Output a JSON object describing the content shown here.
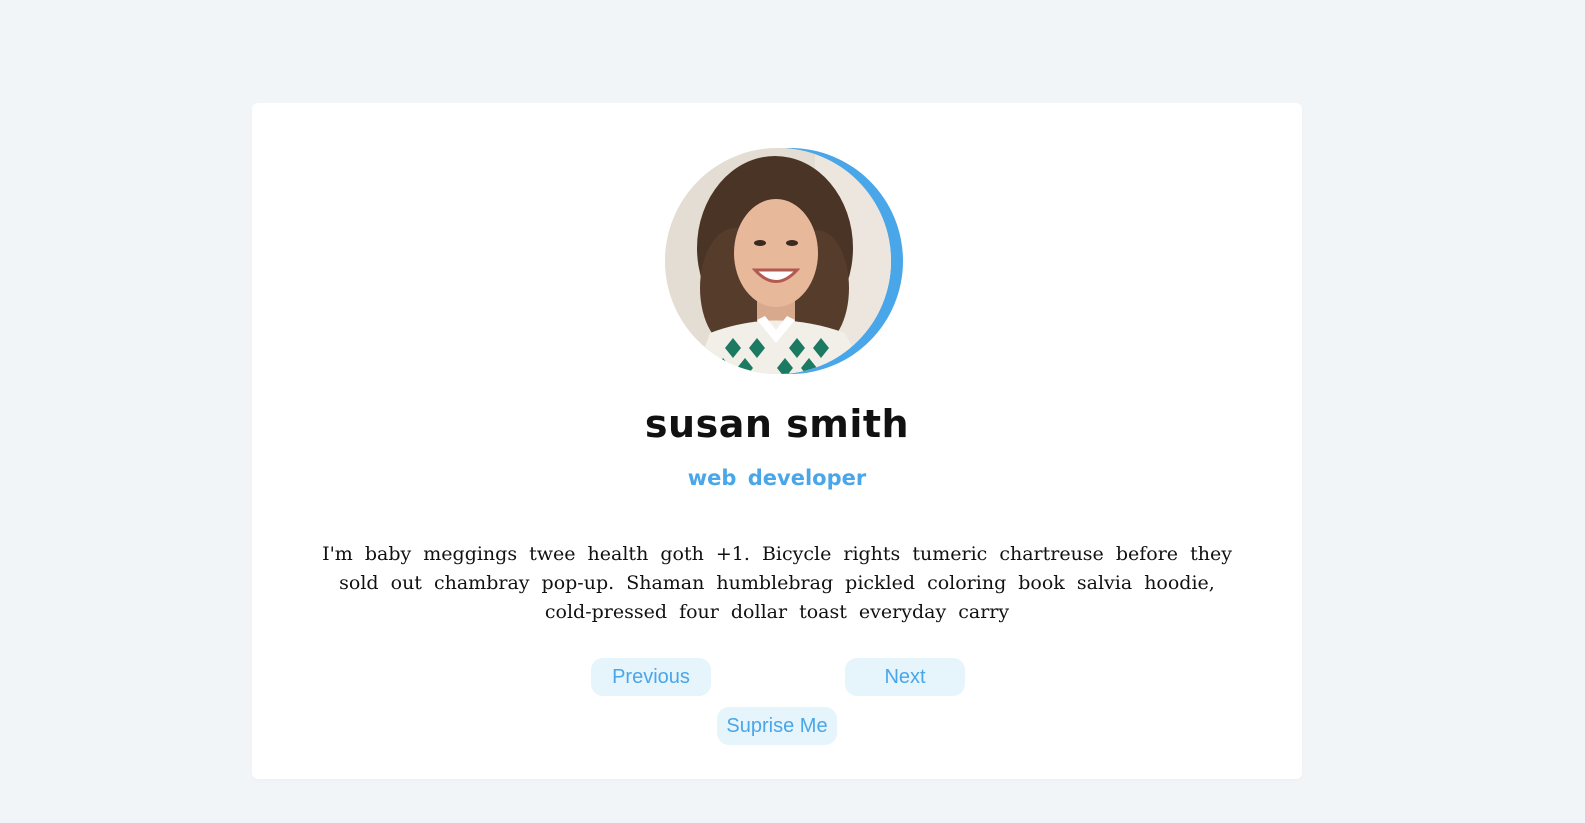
{
  "review": {
    "name": "susan smith",
    "job": "web developer",
    "text": "I'm baby meggings twee health goth +1. Bicycle rights tumeric chartreuse before they sold out chambray pop-up. Shaman humblebrag pickled coloring book salvia hoodie, cold-pressed four dollar toast everyday carry",
    "avatar_alt": "person-img"
  },
  "buttons": {
    "previous": "Previous",
    "next": "Next",
    "random": "Suprise Me"
  },
  "colors": {
    "accent": "#49a6e9",
    "button_bg": "#e6f4fc",
    "page_bg": "#f1f5f8"
  }
}
